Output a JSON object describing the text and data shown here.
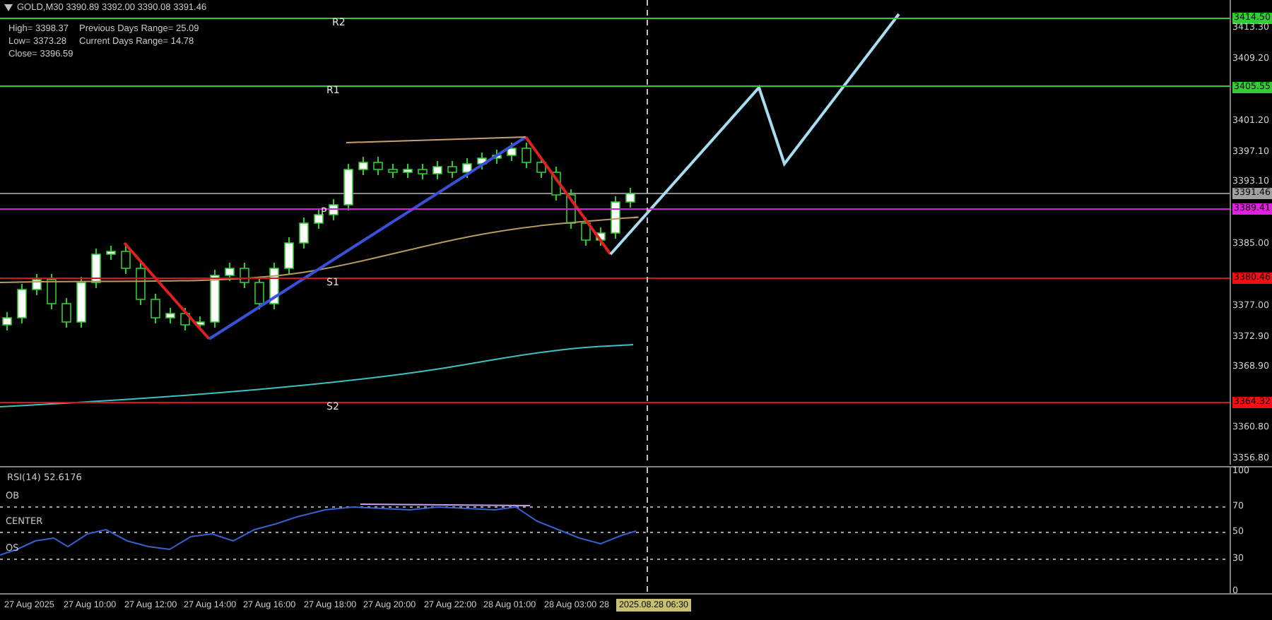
{
  "header": {
    "title": "GOLD,M30  3390.89 3392.00 3390.08 3391.46"
  },
  "daily_info": [
    "High= 3398.37",
    "Previous Days Range= 25.09",
    "Low= 3373.28",
    "Current Days Range= 14.78",
    "Close= 3396.59"
  ],
  "pivot_levels": [
    {
      "label": "R2",
      "color": "#2ecc2e"
    },
    {
      "label": "R1",
      "color": "#2ecc2e"
    },
    {
      "label": "P",
      "color": "#d020d0"
    },
    {
      "label": "S1",
      "color": "#d01818"
    },
    {
      "label": "S2",
      "color": "#d01818"
    }
  ],
  "price_axis": [
    {
      "text": "3414.50",
      "kind": "tag",
      "color": "#33cc33"
    },
    {
      "text": "3413.30",
      "kind": "tick"
    },
    {
      "text": "3409.20",
      "kind": "tick"
    },
    {
      "text": "3405.55",
      "kind": "tag",
      "color": "#33cc33"
    },
    {
      "text": "3401.20",
      "kind": "tick"
    },
    {
      "text": "3397.10",
      "kind": "tick"
    },
    {
      "text": "3393.10",
      "kind": "tick"
    },
    {
      "text": "3391.46",
      "kind": "tag",
      "color": "#a0a0a0"
    },
    {
      "text": "3389.41",
      "kind": "tag",
      "color": "#e020e0"
    },
    {
      "text": "3385.00",
      "kind": "tick"
    },
    {
      "text": "3380.46",
      "kind": "tag",
      "color": "#ee1111"
    },
    {
      "text": "3377.00",
      "kind": "tick"
    },
    {
      "text": "3372.90",
      "kind": "tick"
    },
    {
      "text": "3368.90",
      "kind": "tick"
    },
    {
      "text": "3364.32",
      "kind": "tag",
      "color": "#ee1111"
    },
    {
      "text": "3360.80",
      "kind": "tick"
    },
    {
      "text": "3356.80",
      "kind": "tick"
    }
  ],
  "rsi": {
    "title": "RSI(14) 52.6176",
    "levels": [
      "OB",
      "CENTER",
      "OS"
    ],
    "axis": [
      "100",
      "70",
      "50",
      "30",
      "0"
    ]
  },
  "time_axis": [
    "27 Aug 2025",
    "27 Aug 10:00",
    "27 Aug 12:00",
    "27 Aug 14:00",
    "27 Aug 16:00",
    "27 Aug 18:00",
    "27 Aug 20:00",
    "27 Aug 22:00",
    "28 Aug 01:00",
    "28 Aug 03:00",
    "28"
  ],
  "cursor_time": "2025.08.28 06:30"
}
